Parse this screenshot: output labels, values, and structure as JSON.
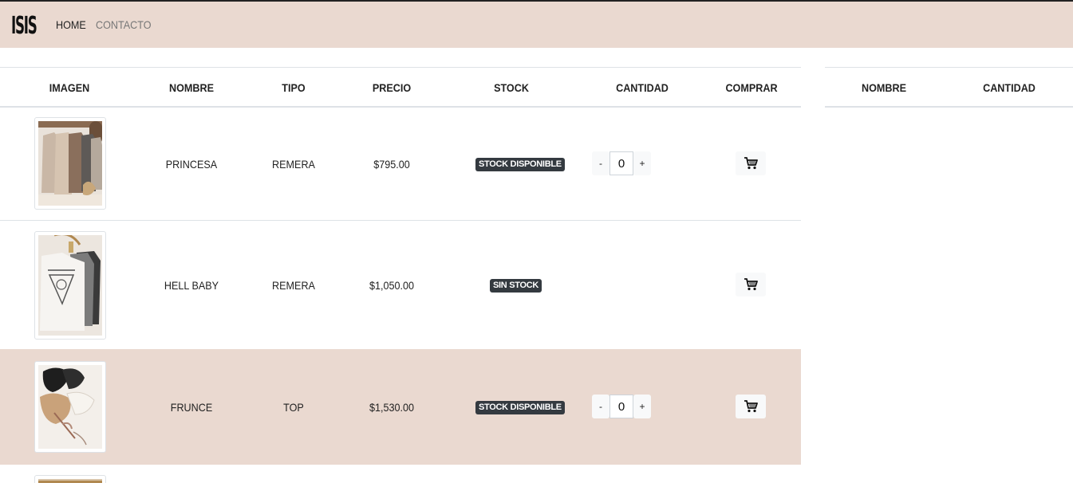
{
  "navbar": {
    "brand": "ISIS",
    "links": [
      {
        "label": "HOME"
      },
      {
        "label": "CONTACTO"
      }
    ]
  },
  "products_table": {
    "headers": [
      "IMAGEN",
      "NOMBRE",
      "TIPO",
      "PRECIO",
      "STOCK",
      "CANTIDAD",
      "COMPRAR"
    ],
    "rows": [
      {
        "nombre": "PRINCESA",
        "tipo": "REMERA",
        "precio": "$795.00",
        "stock": "STOCK DISPONIBLE",
        "cantidad": "0",
        "minus": "-",
        "plus": "+"
      },
      {
        "nombre": "HELL BABY",
        "tipo": "REMERA",
        "precio": "$1,050.00",
        "stock": "SIN STOCK"
      },
      {
        "nombre": "FRUNCE",
        "tipo": "TOP",
        "precio": "$1,530.00",
        "stock": "STOCK DISPONIBLE",
        "cantidad": "0",
        "minus": "-",
        "plus": "+"
      }
    ]
  },
  "cart_table": {
    "headers": [
      "NOMBRE",
      "CANTIDAD"
    ]
  },
  "colors": {
    "accent": "#ead9d0",
    "badge": "#343a40"
  },
  "icons": [
    "cart-icon"
  ]
}
